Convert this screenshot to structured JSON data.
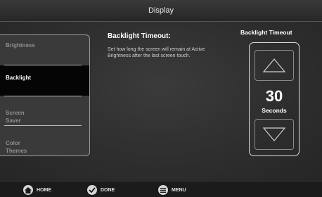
{
  "window": {
    "title": "Display"
  },
  "sidebar": {
    "items": [
      {
        "label": "Brightness"
      },
      {
        "label": "Backlight"
      },
      {
        "label": "Screen\nSaver"
      },
      {
        "label": "Color\nThemes"
      }
    ]
  },
  "details": {
    "title": "Backlight Timeout:",
    "description": "Set how long the screen will remain at Active Brightness after the last screen touch."
  },
  "timeout_control": {
    "label": "Backlight Timeout",
    "value": "30",
    "unit": "Seconds"
  },
  "bottom_nav": {
    "home": "HOME",
    "done": "DONE",
    "menu": "MENU"
  },
  "colors": {
    "background": "#2a2a2a",
    "active_item": "#050505",
    "accent": "#ffffff"
  }
}
